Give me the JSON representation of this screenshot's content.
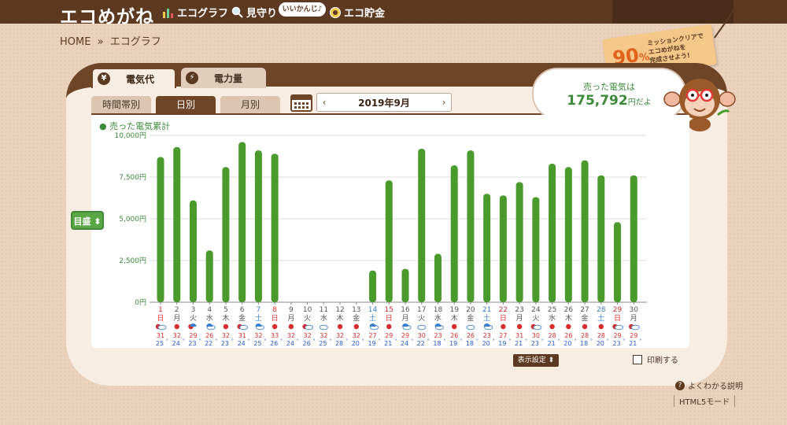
{
  "header": {
    "brand": "エコめがね",
    "nav": [
      {
        "label": "エコグラフ",
        "icon": "bar-chart-icon"
      },
      {
        "label": "見守り",
        "icon": "magnifier-icon"
      },
      {
        "label": "エコ貯金",
        "icon": "coin-icon"
      }
    ],
    "bubble": "いいかんじ♪"
  },
  "breadcrumb": {
    "home": "HOME",
    "sep": "»",
    "current": "エコグラフ"
  },
  "mission": {
    "percent": "90",
    "unit": "%",
    "message_l1": "ミッションクリアで",
    "message_l2": "エコめがねを",
    "message_l3": "完成させよう!"
  },
  "tabs": {
    "electricity_cost": "電気代",
    "electricity_amount": "電力量",
    "yen_symbol": "¥"
  },
  "subtabs": {
    "hourly": "時間帯別",
    "daily": "日別",
    "monthly": "月別"
  },
  "date": {
    "prev": "‹",
    "label": "2019年9月",
    "next": "›"
  },
  "sold": {
    "line1": "売った電気は",
    "value": "175,792",
    "suffix": "円だよ"
  },
  "chart_title": "● 売った電気累計",
  "target_button": "目盛 ⬍",
  "footer": {
    "display_settings": "表示設定 ⬍",
    "print": "印刷する",
    "help": "よくわかる説明",
    "html5": "HTML5モード"
  },
  "colors": {
    "bar": "#4a9a2c",
    "sun": "#d62d2d",
    "saturday": "#3a7fd0",
    "sunday": "#d62d2d",
    "weekday": "#555555",
    "low": "#2a5bd0"
  },
  "chart_data": {
    "type": "bar",
    "ylabel": "",
    "ylim": [
      0,
      10000
    ],
    "yticks": [
      "0円",
      "2,500円",
      "5,000円",
      "7,500円",
      "10,000円"
    ],
    "categories": [
      "1",
      "2",
      "3",
      "4",
      "5",
      "6",
      "7",
      "8",
      "9",
      "10",
      "11",
      "12",
      "13",
      "14",
      "15",
      "16",
      "17",
      "18",
      "19",
      "20",
      "21",
      "22",
      "23",
      "24",
      "25",
      "26",
      "27",
      "28",
      "29",
      "30"
    ],
    "weekdays": [
      "日",
      "月",
      "火",
      "水",
      "木",
      "金",
      "土",
      "日",
      "月",
      "火",
      "水",
      "木",
      "金",
      "土",
      "日",
      "月",
      "火",
      "水",
      "木",
      "金",
      "土",
      "日",
      "月",
      "火",
      "水",
      "木",
      "金",
      "土",
      "日",
      "月"
    ],
    "values": [
      8700,
      9300,
      6100,
      3100,
      8100,
      9600,
      9100,
      8900,
      0,
      0,
      0,
      0,
      0,
      1900,
      7300,
      2000,
      9200,
      2900,
      8200,
      9100,
      6500,
      6400,
      7200,
      6300,
      8300,
      8100,
      8500,
      7600,
      4800,
      7600
    ],
    "weather": [
      "sun-cloud",
      "sun",
      "sun-rain",
      "cloud-rain",
      "sun",
      "sun-cloud",
      "cloud-rain",
      "sun",
      "sun",
      "sun-cloud",
      "cloud",
      "sun",
      "sun",
      "cloud-rain",
      "sun",
      "cloud-rain",
      "cloud",
      "cloud-rain",
      "sun",
      "cloud",
      "cloud-rain",
      "sun",
      "sun",
      "sun-cloud",
      "sun",
      "sun",
      "sun",
      "sun",
      "sun-cloud",
      "sun-cloud"
    ],
    "high_temp": [
      "31",
      "32",
      "29",
      "26",
      "32",
      "31",
      "32",
      "33",
      "32",
      "32",
      "32",
      "32",
      "32",
      "27",
      "29",
      "29",
      "30",
      "23",
      "26",
      "26",
      "23",
      "27",
      "31",
      "30",
      "28",
      "26",
      "28",
      "28",
      "29",
      "29"
    ],
    "low_temp": [
      "25",
      "24",
      "23",
      "22",
      "23",
      "24",
      "25",
      "26",
      "24",
      "26",
      "25",
      "28",
      "20",
      "19",
      "21",
      "24",
      "22",
      "18",
      "19",
      "18",
      "20",
      "19",
      "21",
      "23",
      "21",
      "20",
      "18",
      "20",
      "23",
      "21"
    ],
    "temp_unit": "°"
  }
}
